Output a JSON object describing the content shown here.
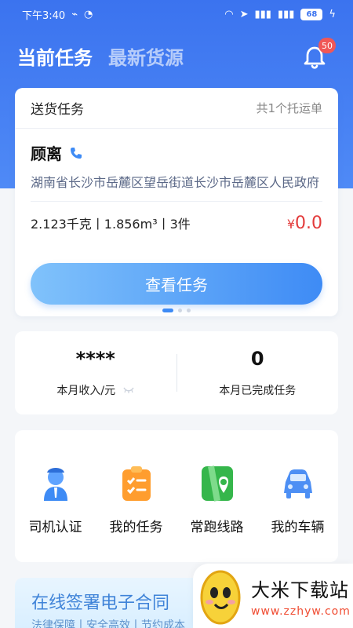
{
  "status": {
    "time": "下午3:40",
    "battery": "68"
  },
  "header": {
    "tabs": [
      "当前任务",
      "最新货源"
    ],
    "notification_count": "50"
  },
  "task": {
    "title": "送货任务",
    "count": "共1个托运单",
    "recipient": "顾离",
    "address": "湖南省长沙市岳麓区望岳街道长沙市岳麓区人民政府",
    "cargo": "2.123千克丨1.856m³丨3件",
    "price_currency": "¥",
    "price_value": "0.0",
    "view_button": "查看任务"
  },
  "stats": [
    {
      "value": "****",
      "label": "本月收入/元"
    },
    {
      "value": "0",
      "label": "本月已完成任务"
    }
  ],
  "menu": [
    {
      "label": "司机认证",
      "icon": "driver-icon"
    },
    {
      "label": "我的任务",
      "icon": "task-list-icon"
    },
    {
      "label": "常跑线路",
      "icon": "route-map-icon"
    },
    {
      "label": "我的车辆",
      "icon": "car-icon"
    }
  ],
  "promo": {
    "title": "在线签署电子合同",
    "subtitle": "法律保障丨安全高效丨节约成本"
  },
  "watermark": {
    "brand": "大米下载站",
    "url": "www.zzhyw.com"
  },
  "colors": {
    "primary": "#3b73ef",
    "price": "#e33b3b"
  }
}
